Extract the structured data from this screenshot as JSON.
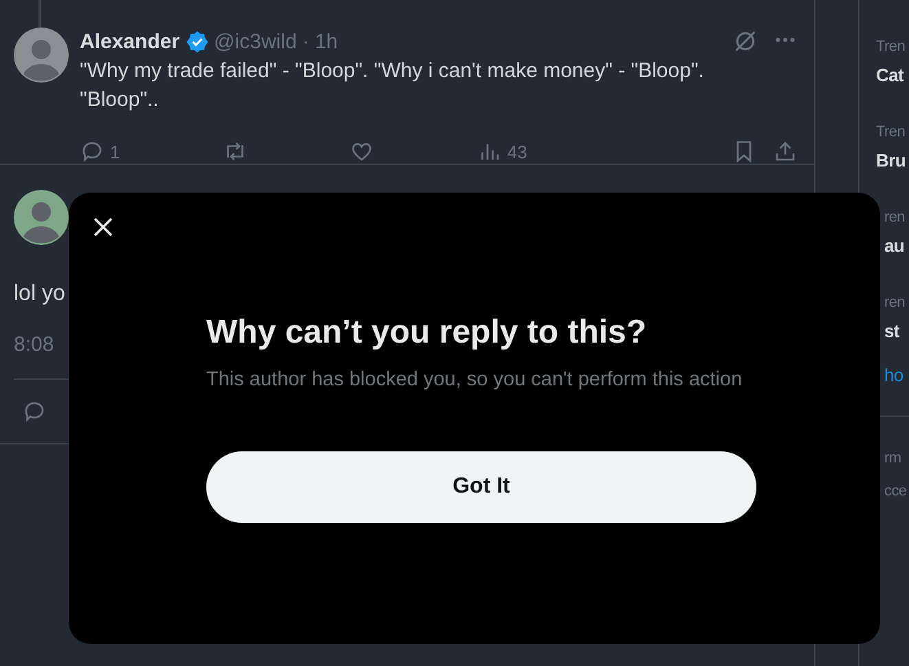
{
  "tweets": [
    {
      "name": "Alexander",
      "verified": true,
      "handle": "@ic3wild",
      "time": "· 1h",
      "text": "\"Why my trade failed\" - \"Bloop\". \"Why i can't make money\" - \"Bloop\". \"Bloop\"..",
      "replies": "1",
      "views": "43"
    },
    {
      "text": "lol yo",
      "time": "8:08"
    }
  ],
  "trends": [
    {
      "kind": "full",
      "label": "Tren",
      "title": "Cat"
    },
    {
      "kind": "full",
      "label": "Tren",
      "title": "Bru"
    },
    {
      "kind": "partial",
      "label": "ren",
      "title": "au"
    },
    {
      "kind": "partial",
      "label": "ren",
      "title": "st"
    }
  ],
  "show_more": "ho",
  "footer": [
    "rm",
    "cce"
  ],
  "dialog": {
    "title": "Why can’t you reply to this?",
    "message": "This author has blocked you, so you can't perform this action",
    "button": "Got It"
  }
}
